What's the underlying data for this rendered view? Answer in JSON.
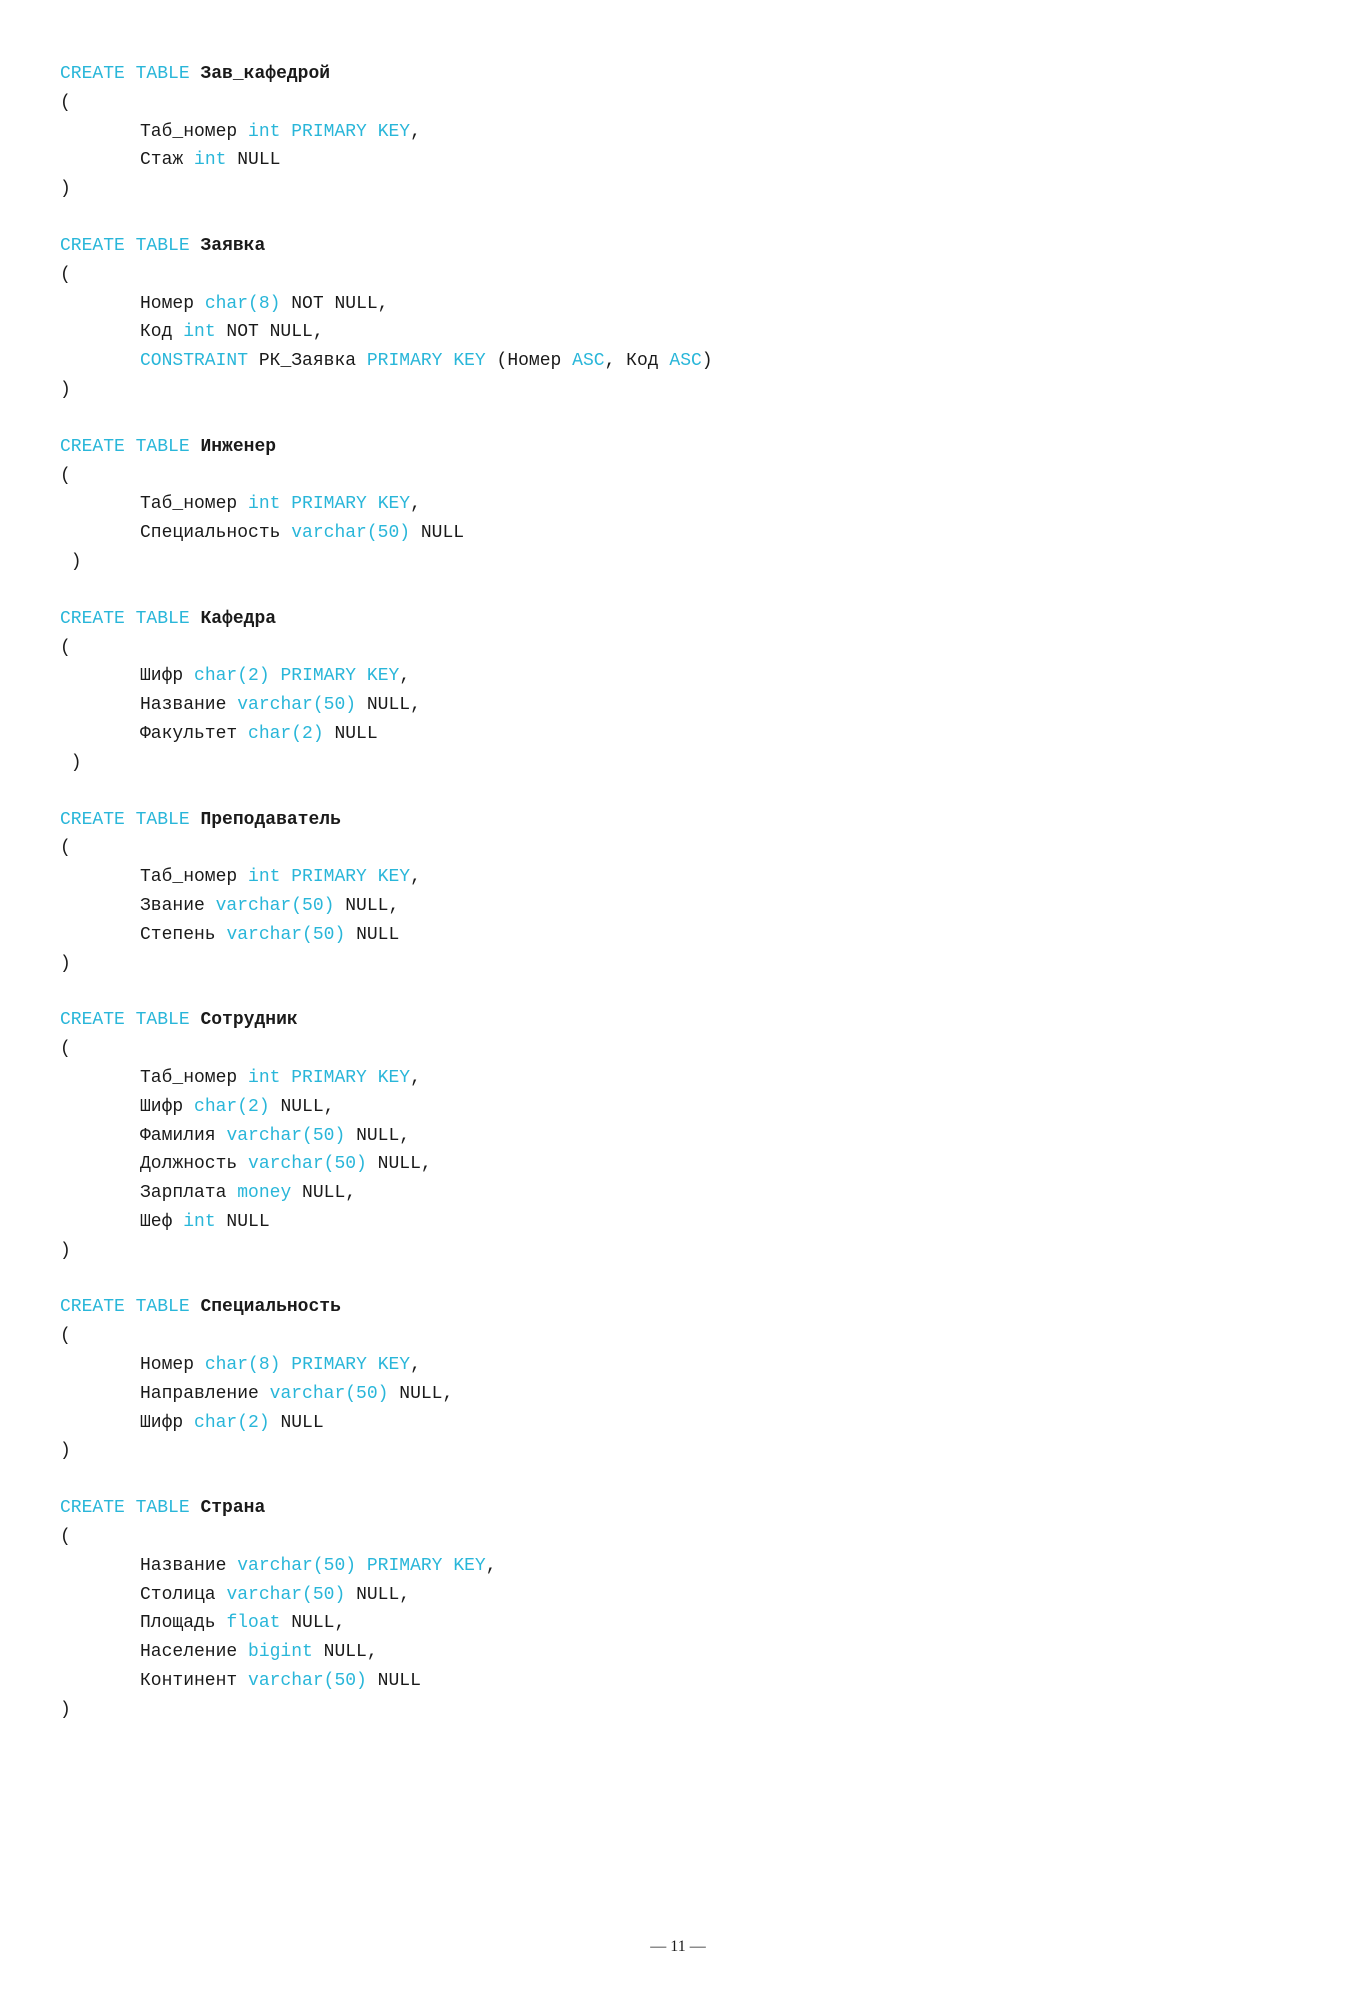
{
  "page": {
    "number": "— 11 —"
  },
  "blocks": [
    {
      "id": "zav_kafedroy",
      "create": "CREATE",
      "table": "TABLE",
      "name": "Зав_кафедрой",
      "fields": [
        {
          "fname": "Таб_номер",
          "ftype": "int",
          "constraint": "PRIMARY KEY"
        },
        {
          "fname": "Стаж",
          "ftype": "int",
          "constraint": "NULL"
        }
      ]
    },
    {
      "id": "zayavka",
      "create": "CREATE",
      "table": "TABLE",
      "name": "Заявка",
      "fields": [
        {
          "fname": "Номер",
          "ftype": "char(8)",
          "constraint": "NOT NULL"
        },
        {
          "fname": "Код",
          "ftype": "int",
          "constraint": "NOT NULL"
        },
        {
          "fname": "CONSTRAINT",
          "special": "PK_Заявка PRIMARY KEY (Номер ASC, Код ASC)"
        }
      ]
    },
    {
      "id": "inzhener",
      "create": "CREATE",
      "table": "TABLE",
      "name": "Инженер",
      "fields": [
        {
          "fname": "Таб_номер",
          "ftype": "int",
          "constraint": "PRIMARY KEY"
        },
        {
          "fname": "Специальность",
          "ftype": "varchar(50)",
          "constraint": "NULL"
        }
      ]
    },
    {
      "id": "kafedra",
      "create": "CREATE",
      "table": "TABLE",
      "name": "Кафедра",
      "fields": [
        {
          "fname": "Шифр",
          "ftype": "char(2)",
          "constraint": "PRIMARY KEY"
        },
        {
          "fname": "Название",
          "ftype": "varchar(50)",
          "constraint": "NULL"
        },
        {
          "fname": "Факультет",
          "ftype": "char(2)",
          "constraint": "NULL"
        }
      ]
    },
    {
      "id": "prepodavatel",
      "create": "CREATE",
      "table": "TABLE",
      "name": "Преподаватель",
      "fields": [
        {
          "fname": "Таб_номер",
          "ftype": "int",
          "constraint": "PRIMARY KEY"
        },
        {
          "fname": "Звание",
          "ftype": "varchar(50)",
          "constraint": "NULL"
        },
        {
          "fname": "Степень",
          "ftype": "varchar(50)",
          "constraint": "NULL"
        }
      ]
    },
    {
      "id": "sotrudnik",
      "create": "CREATE",
      "table": "TABLE",
      "name": "Сотрудник",
      "fields": [
        {
          "fname": "Таб_номер",
          "ftype": "int",
          "constraint": "PRIMARY KEY"
        },
        {
          "fname": "Шифр",
          "ftype": "char(2)",
          "constraint": "NULL"
        },
        {
          "fname": "Фамилия",
          "ftype": "varchar(50)",
          "constraint": "NULL"
        },
        {
          "fname": "Должность",
          "ftype": "varchar(50)",
          "constraint": "NULL"
        },
        {
          "fname": "Зарплата",
          "ftype": "money",
          "constraint": "NULL"
        },
        {
          "fname": "Шеф",
          "ftype": "int",
          "constraint": "NULL"
        }
      ]
    },
    {
      "id": "specialnost",
      "create": "CREATE",
      "table": "TABLE",
      "name": "Специальность",
      "fields": [
        {
          "fname": "Номер",
          "ftype": "char(8)",
          "constraint": "PRIMARY KEY"
        },
        {
          "fname": "Направление",
          "ftype": "varchar(50)",
          "constraint": "NULL"
        },
        {
          "fname": "Шифр",
          "ftype": "char(2)",
          "constraint": "NULL"
        }
      ]
    },
    {
      "id": "strana",
      "create": "CREATE",
      "table": "TABLE",
      "name": "Страна",
      "fields": [
        {
          "fname": "Название",
          "ftype": "varchar(50)",
          "constraint": "PRIMARY KEY"
        },
        {
          "fname": "Столица",
          "ftype": "varchar(50)",
          "constraint": "NULL"
        },
        {
          "fname": "Площадь",
          "ftype": "float",
          "constraint": "NULL"
        },
        {
          "fname": "Население",
          "ftype": "bigint",
          "constraint": "NULL"
        },
        {
          "fname": "Континент",
          "ftype": "varchar(50)",
          "constraint": "NULL"
        }
      ]
    }
  ]
}
